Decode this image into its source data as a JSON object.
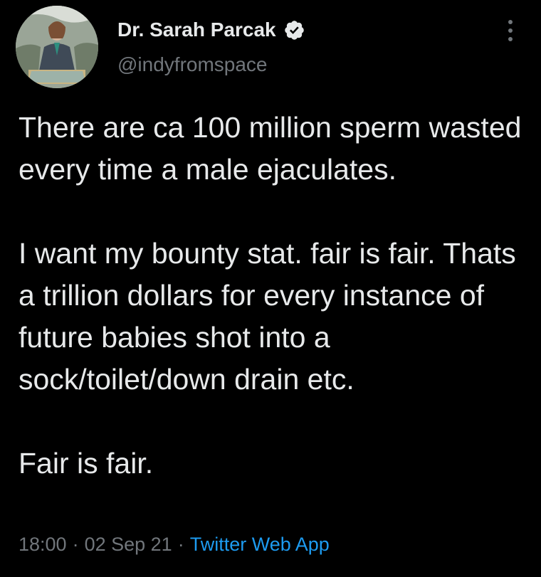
{
  "author": {
    "name": "Dr. Sarah Parcak",
    "handle": "@indyfromspace",
    "verified": true,
    "avatar_icon": "profile-photo"
  },
  "tweet": {
    "paragraphs": [
      "There are ca 100 million sperm wasted every time a male ejaculates.",
      "I want my bounty stat. fair is fair. Thats a trillion dollars for every instance of future babies shot into a sock/toilet/down drain etc.",
      "Fair is fair."
    ]
  },
  "meta": {
    "time": "18:00",
    "date": "02 Sep 21",
    "separator": "·",
    "source": "Twitter Web App"
  },
  "icons": {
    "verified": "verified-badge-icon",
    "more": "more-options-icon"
  },
  "colors": {
    "background": "#000000",
    "text_primary": "#e7e9ea",
    "text_secondary": "#71767b",
    "link": "#1d9bf0"
  }
}
